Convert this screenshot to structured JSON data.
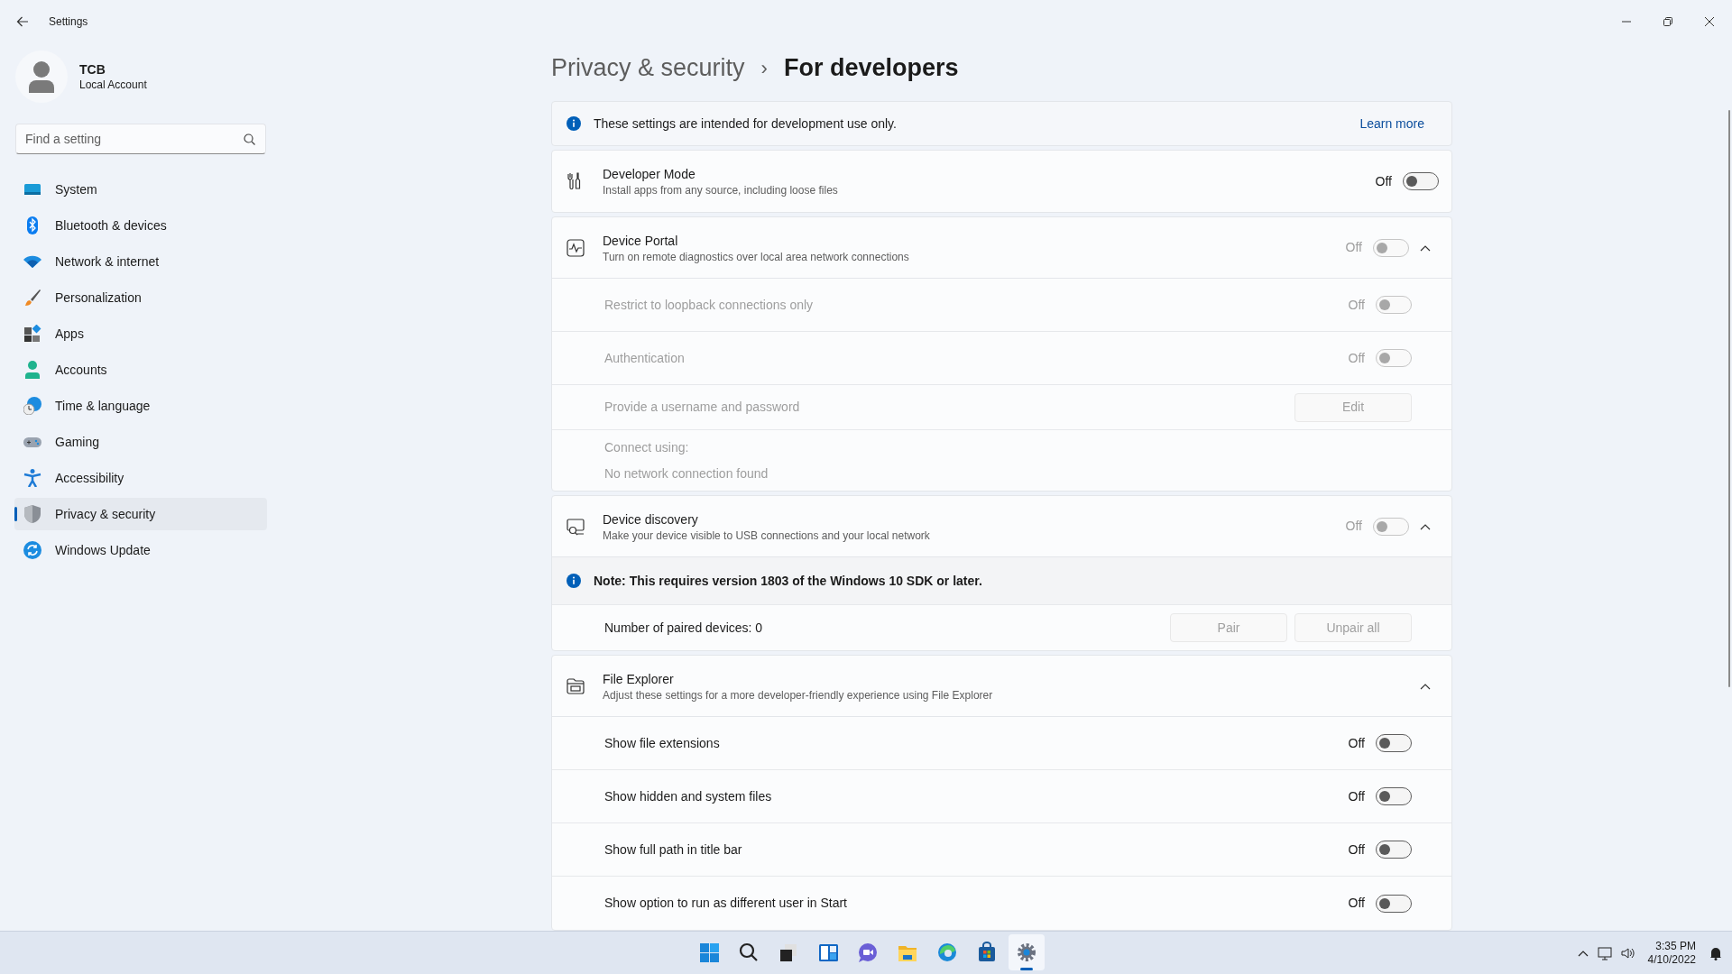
{
  "window": {
    "title": "Settings"
  },
  "user": {
    "name": "TCB",
    "account_type": "Local Account"
  },
  "search": {
    "placeholder": "Find a setting"
  },
  "nav": [
    {
      "label": "System",
      "selected": false
    },
    {
      "label": "Bluetooth & devices",
      "selected": false
    },
    {
      "label": "Network & internet",
      "selected": false
    },
    {
      "label": "Personalization",
      "selected": false
    },
    {
      "label": "Apps",
      "selected": false
    },
    {
      "label": "Accounts",
      "selected": false
    },
    {
      "label": "Time & language",
      "selected": false
    },
    {
      "label": "Gaming",
      "selected": false
    },
    {
      "label": "Accessibility",
      "selected": false
    },
    {
      "label": "Privacy & security",
      "selected": true
    },
    {
      "label": "Windows Update",
      "selected": false
    }
  ],
  "breadcrumb": {
    "parent": "Privacy & security",
    "separator": "›",
    "current": "For developers"
  },
  "info_banner": {
    "text": "These settings are intended for development use only.",
    "link": "Learn more"
  },
  "cards": [
    {
      "title": "Developer Mode",
      "description": "Install apps from any source, including loose files",
      "toggle": {
        "state_text": "Off",
        "on": false,
        "disabled": false
      }
    },
    {
      "title": "Device Portal",
      "description": "Turn on remote diagnostics over local area network connections",
      "toggle": {
        "state_text": "Off",
        "on": false,
        "disabled": true
      },
      "expanded": true,
      "rows": [
        {
          "kind": "toggle",
          "label": "Restrict to loopback connections only",
          "disabled": true,
          "toggle": {
            "state_text": "Off",
            "on": false,
            "disabled": true
          }
        },
        {
          "kind": "toggle",
          "label": "Authentication",
          "disabled": true,
          "toggle": {
            "state_text": "Off",
            "on": false,
            "disabled": true
          }
        },
        {
          "kind": "buttons",
          "label": "Provide a username and password",
          "disabled": true,
          "buttons": [
            {
              "label": "Edit",
              "disabled": true
            }
          ]
        },
        {
          "kind": "text",
          "disabled": true,
          "lines": [
            "Connect using:",
            "No network connection found"
          ]
        }
      ]
    },
    {
      "title": "Device discovery",
      "description": "Make your device visible to USB connections and your local network",
      "toggle": {
        "state_text": "Off",
        "on": false,
        "disabled": true
      },
      "expanded": true,
      "rows": [
        {
          "kind": "note",
          "text": "Note: This requires version 1803 of the Windows 10 SDK or later."
        },
        {
          "kind": "buttons",
          "label": "Number of paired devices: 0",
          "disabled": false,
          "buttons": [
            {
              "label": "Pair",
              "disabled": true
            },
            {
              "label": "Unpair all",
              "disabled": true
            }
          ]
        }
      ]
    },
    {
      "title": "File Explorer",
      "description": "Adjust these settings for a more developer-friendly experience using File Explorer",
      "expanded": true,
      "rows": [
        {
          "kind": "toggle",
          "label": "Show file extensions",
          "disabled": false,
          "toggle": {
            "state_text": "Off",
            "on": false,
            "disabled": false
          }
        },
        {
          "kind": "toggle",
          "label": "Show hidden and system files",
          "disabled": false,
          "toggle": {
            "state_text": "Off",
            "on": false,
            "disabled": false
          }
        },
        {
          "kind": "toggle",
          "label": "Show full path in title bar",
          "disabled": false,
          "toggle": {
            "state_text": "Off",
            "on": false,
            "disabled": false
          }
        },
        {
          "kind": "toggle",
          "label": "Show option to run as different user in Start",
          "disabled": false,
          "toggle": {
            "state_text": "Off",
            "on": false,
            "disabled": false
          }
        }
      ]
    }
  ],
  "taskbar": [
    {
      "kind": "start",
      "selected": false
    },
    {
      "kind": "search",
      "selected": false
    },
    {
      "kind": "taskview",
      "selected": false
    },
    {
      "kind": "widgets",
      "selected": false
    },
    {
      "kind": "chat",
      "selected": false
    },
    {
      "kind": "files",
      "selected": false
    },
    {
      "kind": "browser",
      "selected": false
    },
    {
      "kind": "store",
      "selected": false
    },
    {
      "kind": "settings",
      "selected": true
    }
  ],
  "tray": {
    "time": "3:35 PM",
    "date": "4/10/2022"
  }
}
